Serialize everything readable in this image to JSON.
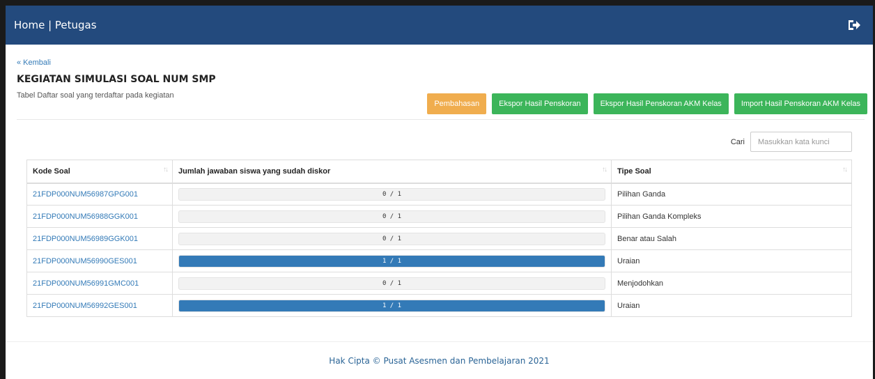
{
  "navbar": {
    "brand": "Home | Petugas",
    "logout_icon": "logout-icon"
  },
  "back_link": "« Kembali",
  "page_title": "KEGIATAN SIMULASI SOAL NUM SMP",
  "subtitle": "Tabel Daftar soal yang terdaftar pada kegiatan",
  "buttons": {
    "pembahasan": "Pembahasan",
    "ekspor": "Ekspor Hasil Penskoran",
    "ekspor_akm": "Ekspor Hasil Penskoran AKM Kelas",
    "import_akm": "Import Hasil Penskoran AKM Kelas"
  },
  "search": {
    "label": "Cari",
    "placeholder": "Masukkan kata kunci"
  },
  "table": {
    "headers": [
      "Kode Soal",
      "Jumlah jawaban siswa yang sudah diskor",
      "Tipe Soal"
    ],
    "rows": [
      {
        "kode": "21FDP000NUM56987GPG001",
        "progress_text": "0 / 1",
        "progress": 0,
        "tipe": "Pilihan Ganda"
      },
      {
        "kode": "21FDP000NUM56988GGK001",
        "progress_text": "0 / 1",
        "progress": 0,
        "tipe": "Pilihan Ganda Kompleks"
      },
      {
        "kode": "21FDP000NUM56989GGK001",
        "progress_text": "0 / 1",
        "progress": 0,
        "tipe": "Benar atau Salah"
      },
      {
        "kode": "21FDP000NUM56990GES001",
        "progress_text": "1 / 1",
        "progress": 1,
        "tipe": "Uraian"
      },
      {
        "kode": "21FDP000NUM56991GMC001",
        "progress_text": "0 / 1",
        "progress": 0,
        "tipe": "Menjodohkan"
      },
      {
        "kode": "21FDP000NUM56992GES001",
        "progress_text": "1 / 1",
        "progress": 1,
        "tipe": "Uraian"
      }
    ]
  },
  "footer": "Hak Cipta © Pusat Asesmen dan Pembelajaran 2021",
  "colors": {
    "navbar": "#234a7d",
    "primary": "#337ab7",
    "warning": "#f0ad4e",
    "success": "#3cb55a"
  }
}
